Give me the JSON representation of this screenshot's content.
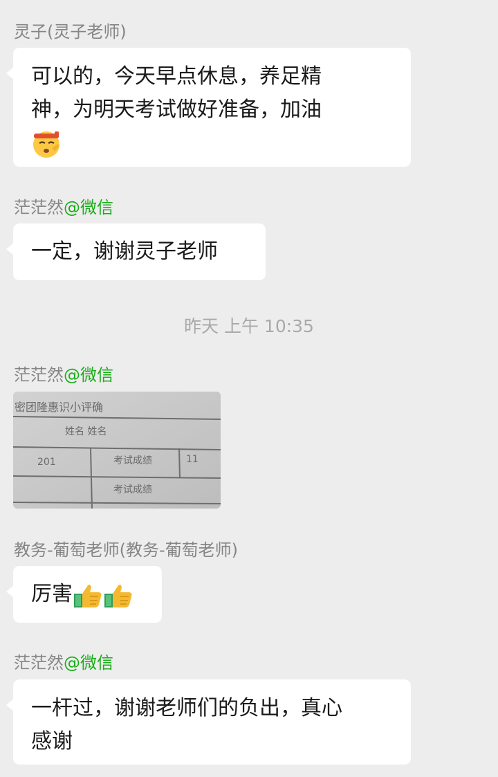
{
  "messages": [
    {
      "sender": "灵子(灵子老师)",
      "lines": [
        "可以的，今天早点休息，养足精",
        "神，为明天考试做好准备，加油"
      ],
      "emoji": "saluting-face-emoji"
    },
    {
      "sender_name": "茫茫然",
      "sender_tag": "@微信",
      "text": "一定，谢谢灵子老师"
    },
    {
      "sender_name": "茫茫然",
      "sender_tag": "@微信",
      "image_text": {
        "row0": "密团隆惠识小评确",
        "row1": "姓名  姓名",
        "row2a": "考试成绩",
        "row2b": "201",
        "row2c": "11",
        "row3": "考试成绩"
      }
    },
    {
      "sender": "教务-葡萄老师(教务-葡萄老师)",
      "text": "厉害",
      "emoji": [
        "thumbs-up-emoji",
        "thumbs-up-emoji"
      ]
    },
    {
      "sender_name": "茫茫然",
      "sender_tag": "@微信",
      "lines": [
        "一杆过，谢谢老师们的负出，真心",
        "感谢"
      ]
    }
  ],
  "timestamp": "昨天 上午 10:35"
}
